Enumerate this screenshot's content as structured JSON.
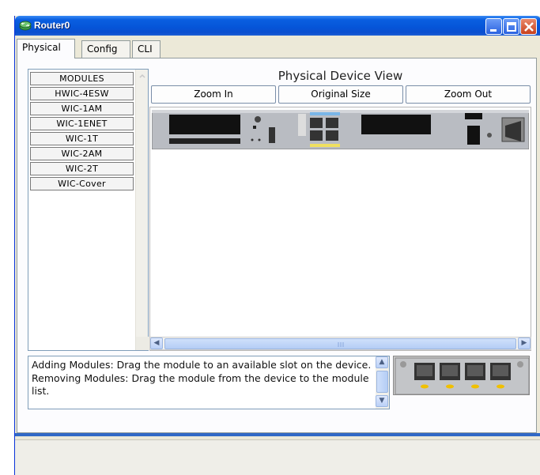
{
  "window": {
    "title": "Router0",
    "icon": "router-icon",
    "controls": [
      "minimize-icon",
      "maximize-icon",
      "close-icon"
    ]
  },
  "tabs": [
    {
      "label": "Physical",
      "active": true
    },
    {
      "label": "Config",
      "active": false
    },
    {
      "label": "CLI",
      "active": false
    }
  ],
  "modules": {
    "header": "MODULES",
    "items": [
      "HWIC-4ESW",
      "WIC-1AM",
      "WIC-1ENET",
      "WIC-1T",
      "WIC-2AM",
      "WIC-2T",
      "WIC-Cover"
    ]
  },
  "physical_view": {
    "title": "Physical Device View",
    "zoom_in": "Zoom In",
    "original_size": "Original Size",
    "zoom_out": "Zoom Out"
  },
  "info": {
    "line1": "Adding Modules: Drag the module to an available slot on the device.",
    "line2": "Removing Modules: Drag the module from the device to the module list."
  },
  "colors": {
    "titlebar": "#0554d8",
    "tab_border": "#919b9c",
    "scroll_thumb": "#b4cdf5"
  }
}
